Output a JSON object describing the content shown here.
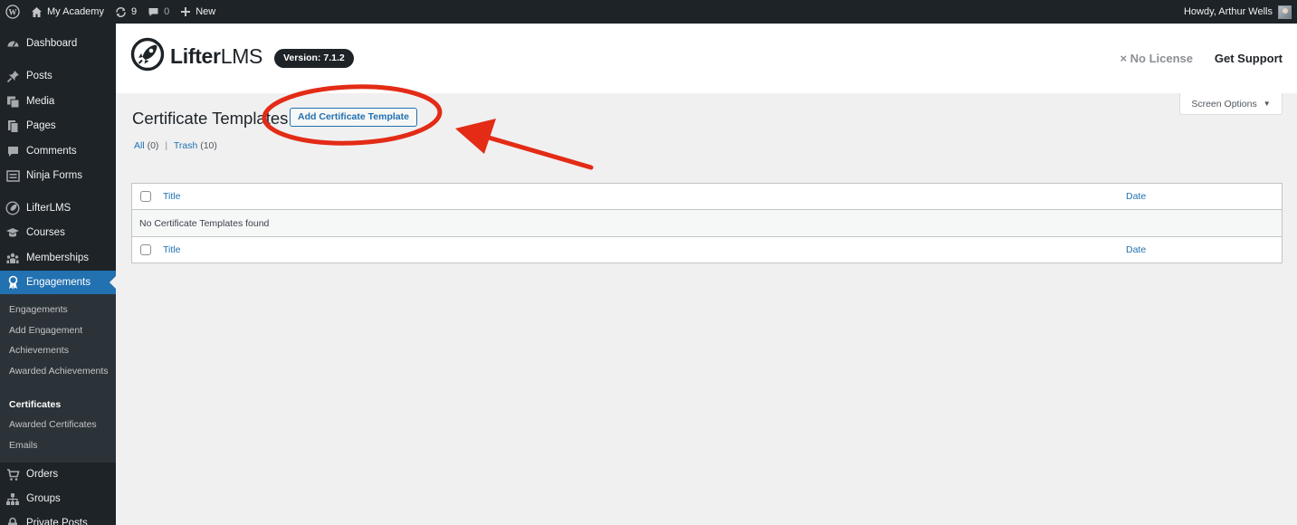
{
  "adminbar": {
    "site_name": "My Academy",
    "updates_count": "9",
    "comments_count": "0",
    "new_label": "New",
    "greeting": "Howdy, Arthur Wells"
  },
  "sidebar": {
    "items": [
      {
        "label": "Dashboard",
        "icon": "dashboard-icon"
      },
      {
        "label": "Posts",
        "icon": "pin-icon"
      },
      {
        "label": "Media",
        "icon": "media-icon"
      },
      {
        "label": "Pages",
        "icon": "pages-icon"
      },
      {
        "label": "Comments",
        "icon": "comment-icon"
      },
      {
        "label": "Ninja Forms",
        "icon": "forms-icon"
      },
      {
        "label": "LifterLMS",
        "icon": "rocket-icon"
      },
      {
        "label": "Courses",
        "icon": "graduation-cap-icon"
      },
      {
        "label": "Memberships",
        "icon": "groups-icon"
      },
      {
        "label": "Engagements",
        "icon": "award-icon"
      },
      {
        "label": "Orders",
        "icon": "cart-icon"
      },
      {
        "label": "Groups",
        "icon": "network-icon"
      },
      {
        "label": "Private Posts",
        "icon": "lock-icon"
      }
    ],
    "submenu": [
      "Engagements",
      "Add Engagement",
      "Achievements",
      "Awarded Achievements",
      "Certificates",
      "Awarded Certificates",
      "Emails"
    ]
  },
  "header": {
    "logo_bold": "Lifter",
    "logo_light": "LMS",
    "version": "Version: 7.1.2",
    "no_license": "× No License",
    "get_support": "Get Support"
  },
  "main": {
    "screen_options": "Screen Options",
    "page_title": "Certificate Templates",
    "add_button": "Add Certificate Template",
    "filters": [
      {
        "label": "All",
        "count": "(0)"
      },
      {
        "label": "Trash",
        "count": "(10)"
      }
    ],
    "separator": "|",
    "table": {
      "col_title": "Title",
      "col_date": "Date",
      "empty_message": "No Certificate Templates found"
    }
  },
  "colors": {
    "adminbar_bg": "#1d2327",
    "accent": "#2271b1",
    "annotation_red": "#e32b16"
  }
}
